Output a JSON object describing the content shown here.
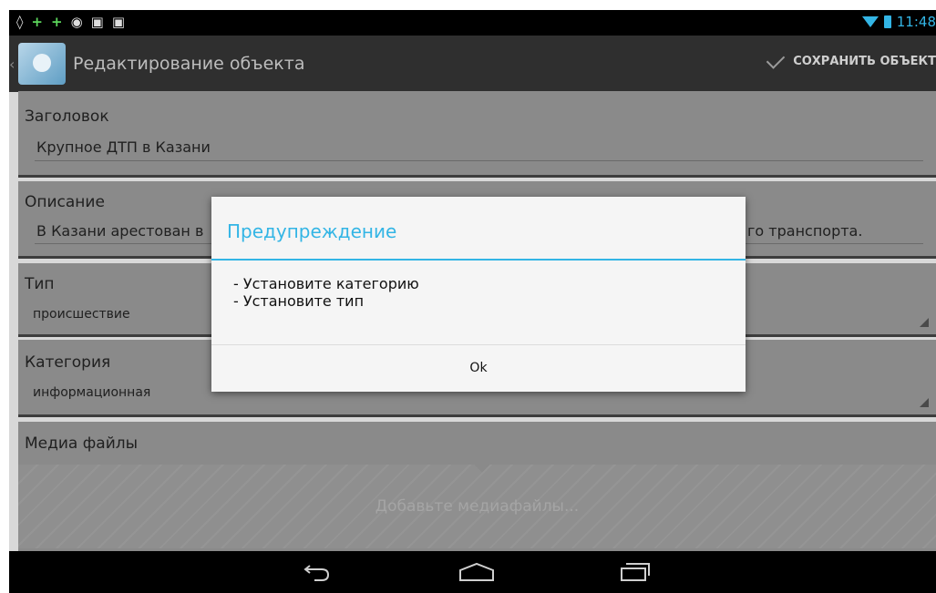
{
  "status_bar": {
    "left_icons": [
      "gps-icon",
      "plus-icon",
      "plus-icon",
      "android-icon",
      "bag-icon",
      "bag-icon"
    ],
    "time": "11:48"
  },
  "action_bar": {
    "title": "Редактирование объекта",
    "save_label": "СОХРАНИТЬ ОБЪЕКТ"
  },
  "form": {
    "title_field": {
      "label": "Заголовок",
      "value": "Крупное ДТП в Казани"
    },
    "description_field": {
      "label": "Описание",
      "value_start": "В Казани арестован в",
      "value_end": "го транспорта."
    },
    "type_field": {
      "label": "Тип",
      "value": "происшествие"
    },
    "category_field": {
      "label": "Категория",
      "value": "информационная"
    },
    "media_field": {
      "label": "Медиа файлы",
      "hint": "Добавьте медиафайлы..."
    }
  },
  "dialog": {
    "title": "Предупреждение",
    "lines": [
      "- Установите категорию",
      "- Установите тип"
    ],
    "ok_label": "Ok"
  },
  "colors": {
    "accent": "#33b5e5"
  }
}
